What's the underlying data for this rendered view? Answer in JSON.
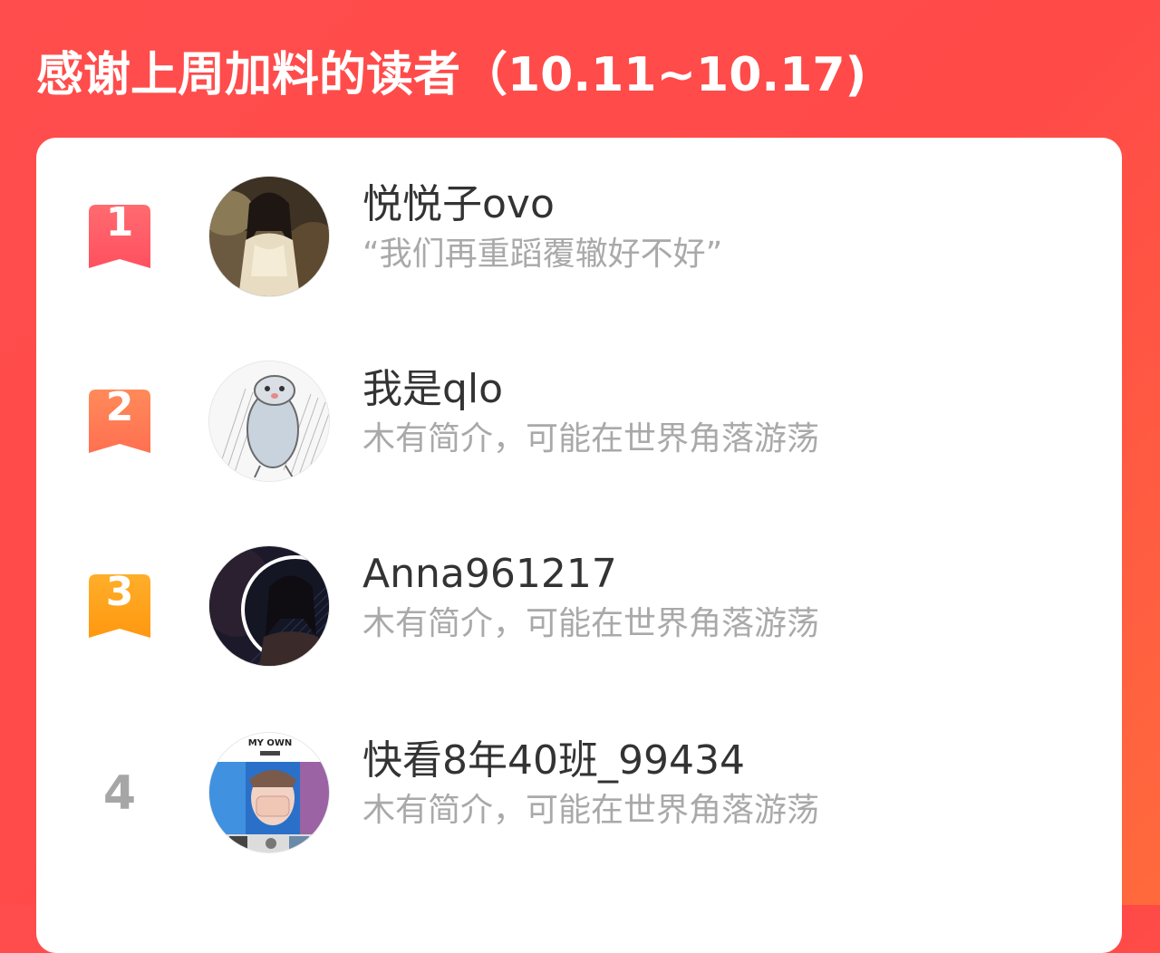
{
  "header": {
    "title": "感谢上周加料的读者（10.11~10.17)"
  },
  "colors": {
    "background_start": "#ff4d4d",
    "background_end": "#ff6a3c",
    "rank1": "#ff5a64",
    "rank2": "#ff7a55",
    "rank3": "#ffa21a",
    "rank_plain": "#a6a6a6",
    "username": "#333333",
    "bio": "#a9a9a9"
  },
  "readers": [
    {
      "rank": "1",
      "name": "悦悦子ovo",
      "bio": "“我们再重蹈覆辙好不好”",
      "avatar_icon": "avatar-photo-girl-icon"
    },
    {
      "rank": "2",
      "name": "我是qlo",
      "bio": "木有简介，可能在世界角落游荡",
      "avatar_icon": "avatar-cartoon-sketch-icon"
    },
    {
      "rank": "3",
      "name": "Anna961217",
      "bio": "木有简介，可能在世界角落游荡",
      "avatar_icon": "avatar-photo-portrait-icon"
    },
    {
      "rank": "4",
      "name": "快看8年40班_99434",
      "bio": "木有简介，可能在世界角落游荡",
      "avatar_icon": "avatar-poster-icon"
    }
  ],
  "avatar_poster": {
    "top_text": "MY OWN"
  }
}
